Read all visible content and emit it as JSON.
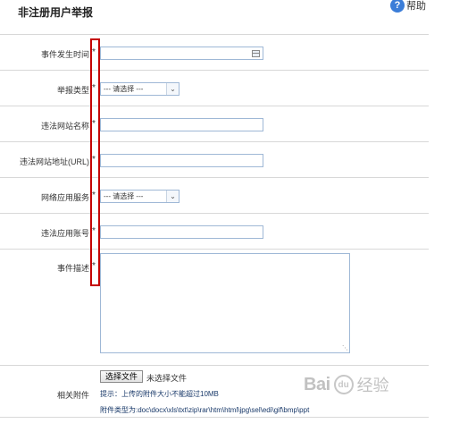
{
  "header": {
    "title": "非注册用户举报",
    "help_label": "帮助"
  },
  "form": {
    "required_mark": "*",
    "event_time": {
      "label": "事件发生时间",
      "value": ""
    },
    "report_type": {
      "label": "举报类型",
      "selected": "--- 请选择 ---"
    },
    "site_name": {
      "label": "违法网站名称",
      "value": ""
    },
    "site_url": {
      "label": "违法网站地址(URL)",
      "value": ""
    },
    "app_service": {
      "label": "网络应用服务",
      "selected": "--- 请选择 ---"
    },
    "app_account": {
      "label": "违法应用账号",
      "value": ""
    },
    "description": {
      "label": "事件描述",
      "value": ""
    },
    "attachment": {
      "label": "相关附件",
      "button_label": "选择文件",
      "status": "未选择文件",
      "hint_size": "提示：上传的附件大小不能超过10MB",
      "hint_types": "附件类型为:doc\\docx\\xls\\txt\\zip\\rar\\htm\\html\\jpg\\sel\\edi\\gif\\bmp\\ppt"
    }
  },
  "watermark": {
    "brand": "Bai",
    "paw": "du",
    "suffix": "经验"
  },
  "colors": {
    "highlight_box": "#c40000",
    "input_border": "#9fb8d6",
    "hint_text": "#1a3a6a"
  }
}
